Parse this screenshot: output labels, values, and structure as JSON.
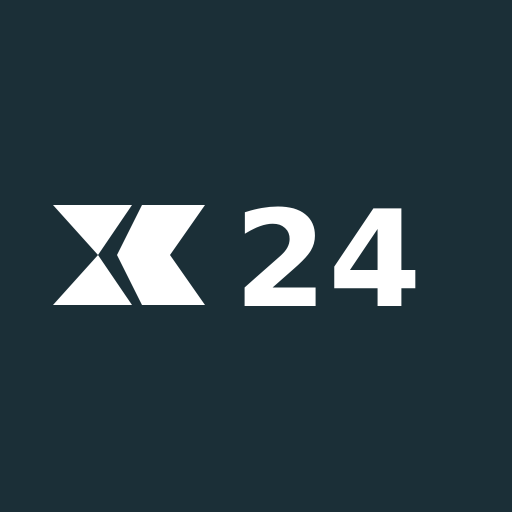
{
  "app": {
    "background_color": "#1b2f37",
    "foreground_color": "#ffffff"
  },
  "logo": {
    "text": "X24",
    "mark_icon": "x-chevron-mark-icon",
    "numerals": "24"
  }
}
